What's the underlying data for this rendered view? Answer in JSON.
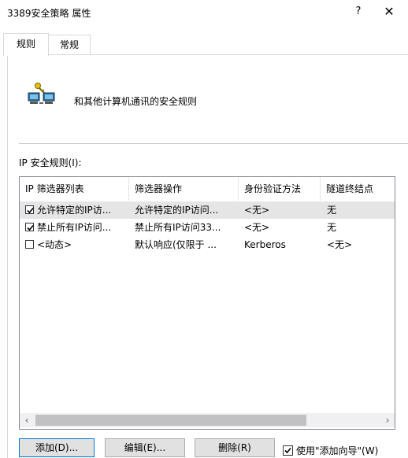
{
  "window": {
    "title": "3389安全策略 属性",
    "help_glyph": "?",
    "close_glyph": "✕"
  },
  "tabs": [
    {
      "label": "规则",
      "active": true
    },
    {
      "label": "常规",
      "active": false
    }
  ],
  "header": {
    "icon": "network-computers-key-icon",
    "text": "和其他计算机通讯的安全规则"
  },
  "rules_list": {
    "label": "IP 安全规则(I):",
    "columns": [
      "IP 筛选器列表",
      "筛选器操作",
      "身份验证方法",
      "隧道终结点"
    ],
    "rows": [
      {
        "checked": true,
        "filter_list": "允许特定的IP访...",
        "filter_action": "允许特定的IP访问...",
        "auth": "<无>",
        "tunnel": "无",
        "selected": true
      },
      {
        "checked": true,
        "filter_list": "禁止所有IP访问...",
        "filter_action": "禁止所有IP访问33...",
        "auth": "<无>",
        "tunnel": "无",
        "selected": false
      },
      {
        "checked": false,
        "filter_list": "<动态>",
        "filter_action": "默认响应(仅限于 ...",
        "auth": "Kerberos",
        "tunnel": "<无>",
        "selected": false
      }
    ],
    "scroll_left": "‹",
    "scroll_right": "›"
  },
  "buttons": {
    "add": "添加(D)...",
    "edit": "编辑(E)...",
    "remove": "删除(R)",
    "use_wizard": "使用\"添加向导\"(W)",
    "use_wizard_checked": true
  },
  "colors": {
    "accent": "#0078d7",
    "selected_row": "#e5e5e5",
    "button_face": "#e1e1e1"
  }
}
